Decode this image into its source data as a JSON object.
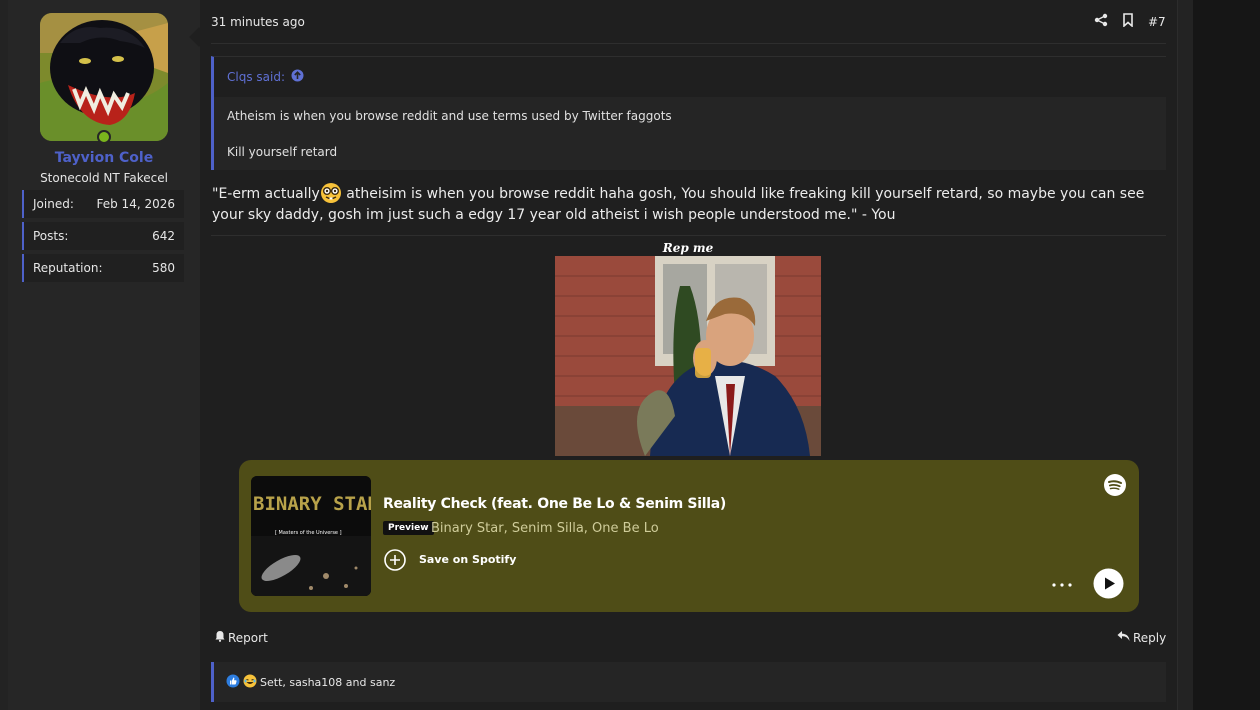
{
  "user": {
    "name": "Tayvion Cole",
    "title": "Stonecold NT Fakecel",
    "stats": [
      {
        "label": "Joined:",
        "value": "Feb 14, 2026"
      },
      {
        "label": "Posts:",
        "value": "642"
      },
      {
        "label": "Reputation:",
        "value": "580"
      }
    ]
  },
  "post": {
    "time": "31 minutes ago",
    "number": "#7",
    "quote": {
      "author": "Clqs said:",
      "lines": [
        "Atheism is when you browse reddit and use terms used by Twitter faggots",
        "Kill yourself retard"
      ]
    },
    "text_before_emoji": "\"E-erm actually",
    "text_after_emoji": " atheisim is when you browse reddit haha gosh, You should like freaking kill yourself retard, so maybe you can see your sky daddy, gosh im just such a edgy 17 year old atheist i wish people understood me.\" - You",
    "emoji": "nerd-face",
    "signature": {
      "title": "Rep me"
    }
  },
  "spotify": {
    "title": "Reality Check (feat. One Be Lo & Senim Silla)",
    "badge": "Preview",
    "artists": "Binary Star, Senim Silla, One Be Lo",
    "save_label": "Save on Spotify",
    "cover_text": "BINARY STAR",
    "cover_subtext": "[ Masters of the Universe ]",
    "bg_color": "#4f4d17"
  },
  "actions": {
    "report": "Report",
    "reply": "Reply"
  },
  "reactions": {
    "names": "Sett, sasha108 and sanz",
    "icons": [
      "like-icon",
      "laugh-icon"
    ]
  },
  "colors": {
    "accent": "#4e61c9",
    "online": "#7ab51d"
  }
}
